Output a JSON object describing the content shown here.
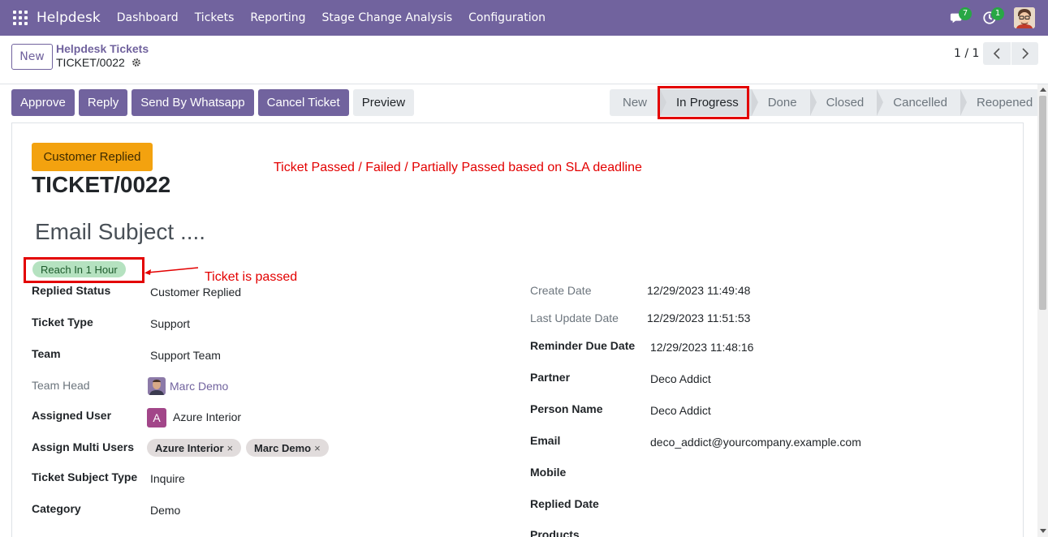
{
  "navbar": {
    "brand": "Helpdesk",
    "menu": [
      "Dashboard",
      "Tickets",
      "Reporting",
      "Stage Change Analysis",
      "Configuration"
    ],
    "messages_count": "7",
    "activities_count": "1"
  },
  "control_panel": {
    "new_label": "New",
    "breadcrumb_parent": "Helpdesk Tickets",
    "breadcrumb_current": "TICKET/0022",
    "pager": "1 / 1"
  },
  "actions": {
    "approve": "Approve",
    "reply": "Reply",
    "whatsapp": "Send By Whatsapp",
    "cancel": "Cancel Ticket",
    "preview": "Preview"
  },
  "stages": [
    "New",
    "In Progress",
    "Done",
    "Closed",
    "Cancelled",
    "Reopened"
  ],
  "active_stage": "In Progress",
  "form": {
    "status_tag": "Customer Replied",
    "ticket_number": "TICKET/0022",
    "email_subject": "Email Subject ....",
    "sla_tag": "Reach In 1 Hour",
    "annotation_top": "Ticket Passed / Failed / Partially Passed based on SLA deadline",
    "annotation_side": "Ticket is passed",
    "left_fields": {
      "replied_status_label": "Replied Status",
      "replied_status": "Customer Replied",
      "ticket_type_label": "Ticket Type",
      "ticket_type": "Support",
      "team_label": "Team",
      "team": "Support Team",
      "team_head_label": "Team Head",
      "team_head": "Marc Demo",
      "assigned_user_label": "Assigned User",
      "assigned_user": "Azure Interior",
      "assigned_user_initial": "A",
      "multi_users_label": "Assign Multi Users",
      "multi_users": [
        "Azure Interior",
        "Marc Demo"
      ],
      "subject_type_label": "Ticket Subject Type",
      "subject_type": "Inquire",
      "category_label": "Category",
      "category": "Demo"
    },
    "right_fields": {
      "create_date_label": "Create Date",
      "create_date": "12/29/2023 11:49:48",
      "last_update_label": "Last Update Date",
      "last_update": "12/29/2023 11:51:53",
      "reminder_label": "Reminder Due Date",
      "reminder": "12/29/2023 11:48:16",
      "partner_label": "Partner",
      "partner": "Deco Addict",
      "person_label": "Person Name",
      "person": "Deco Addict",
      "email_label": "Email",
      "email": "deco_addict@yourcompany.example.com",
      "mobile_label": "Mobile",
      "replied_date_label": "Replied Date",
      "products_label": "Products"
    }
  },
  "colors": {
    "brand": "#71639e",
    "annotation": "#e30000",
    "status_tag": "#f3a20f",
    "sla_tag": "#b5e2c0"
  }
}
